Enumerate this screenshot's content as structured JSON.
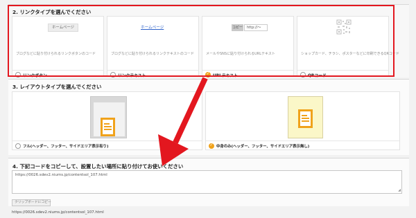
{
  "section1": {
    "title": "2. リンクタイプを選んでください",
    "cards": [
      {
        "preview": "ホームページ",
        "desc": "ブログなどに貼り付けられるリンクボタンのコード",
        "label": "リンクボタン",
        "selected": false
      },
      {
        "preview": "ホームページ",
        "desc": "ブログなどに貼り付けられるリンクテキストのコード",
        "label": "リンクテキスト",
        "selected": false
      },
      {
        "preview_tag": "コピー",
        "preview": "http://〜",
        "desc": "メールやSNSに貼り付けられるURLテキスト",
        "label": "URLテキスト",
        "selected": true
      },
      {
        "preview_icon": "qr-code-icon",
        "desc": "ショップカード、チラシ、ポスターなどに印刷できるQRコード",
        "label": "QRコード",
        "selected": false
      }
    ]
  },
  "section2": {
    "title": "3. レイアウトタイプを選んでください",
    "cards": [
      {
        "label": "フル(ヘッダー、フッター、サイドエリア表示有り)",
        "selected": false,
        "icon": "document-icon"
      },
      {
        "label": "中身のみ(ヘッダー、フッター、サイドエリア表示無し)",
        "selected": true,
        "icon": "document-icon"
      }
    ]
  },
  "section3": {
    "title": "4. 下記コードをコピーして、設置したい場所に貼り付けてお使いください",
    "code": "https://0026.sdev2.niums.jp/contentsol_107.html",
    "copy_button": "クリップボードにコピー"
  },
  "footer_url": "https://0026.sdev2.niums.jp/contentsol_107.html",
  "colors": {
    "accent": "#f0a21b",
    "highlight": "#e3171f",
    "link": "#2a5fc9"
  }
}
